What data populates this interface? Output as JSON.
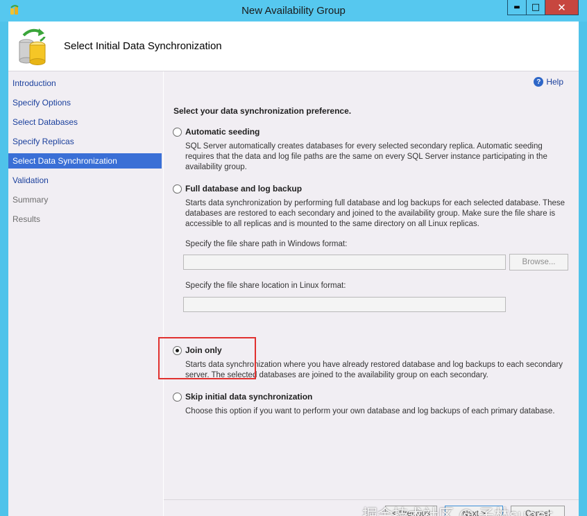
{
  "window": {
    "title": "New Availability Group",
    "controls": {
      "minimize": "▬",
      "maximize": "□",
      "close": "✕"
    }
  },
  "header": {
    "title": "Select Initial Data Synchronization",
    "icon": "database-sync-icon"
  },
  "nav": {
    "items": [
      {
        "label": "Introduction",
        "state": "link"
      },
      {
        "label": "Specify Options",
        "state": "link"
      },
      {
        "label": "Select Databases",
        "state": "link"
      },
      {
        "label": "Specify Replicas",
        "state": "link"
      },
      {
        "label": "Select Data Synchronization",
        "state": "active"
      },
      {
        "label": "Validation",
        "state": "link"
      },
      {
        "label": "Summary",
        "state": "disabled"
      },
      {
        "label": "Results",
        "state": "disabled"
      }
    ]
  },
  "content": {
    "help_label": "Help",
    "help_icon": "?",
    "prompt": "Select your data synchronization preference.",
    "options": [
      {
        "label": "Automatic seeding",
        "checked": false,
        "description": "SQL Server automatically creates databases for every selected secondary replica. Automatic seeding requires that the data and log file paths are the same on every SQL Server instance participating in the availability group."
      },
      {
        "label": "Full database and log backup",
        "checked": false,
        "description": "Starts data synchronization by performing full database and log backups for each selected database. These databases are restored to each secondary and joined to the availability group. Make sure the file share is accessible to all replicas and is mounted to the same directory on all Linux replicas."
      },
      {
        "label": "Join only",
        "checked": true,
        "description": "Starts data synchronization where you have already restored database and log backups to each secondary server. The selected databases are joined to the availability group on each secondary."
      },
      {
        "label": "Skip initial data synchronization",
        "checked": false,
        "description": "Choose this option if you want to perform your own database and log backups of each primary database."
      }
    ],
    "windows_share": {
      "label": "Specify the file share path in Windows format:",
      "value": "",
      "browse_label": "Browse..."
    },
    "linux_share": {
      "label": "Specify the file share location in Linux format:",
      "value": ""
    }
  },
  "footer": {
    "previous_label": "< Previous",
    "next_label": "Next >",
    "cancel_label": "Cancel"
  },
  "watermark": "掘金技术社区 @ 子林super",
  "colors": {
    "titlebar": "#56c8ef",
    "close_button": "#c7463f",
    "nav_active": "#3a6fd6",
    "nav_link": "#1a3f9c",
    "highlight_box": "#e0302e"
  }
}
